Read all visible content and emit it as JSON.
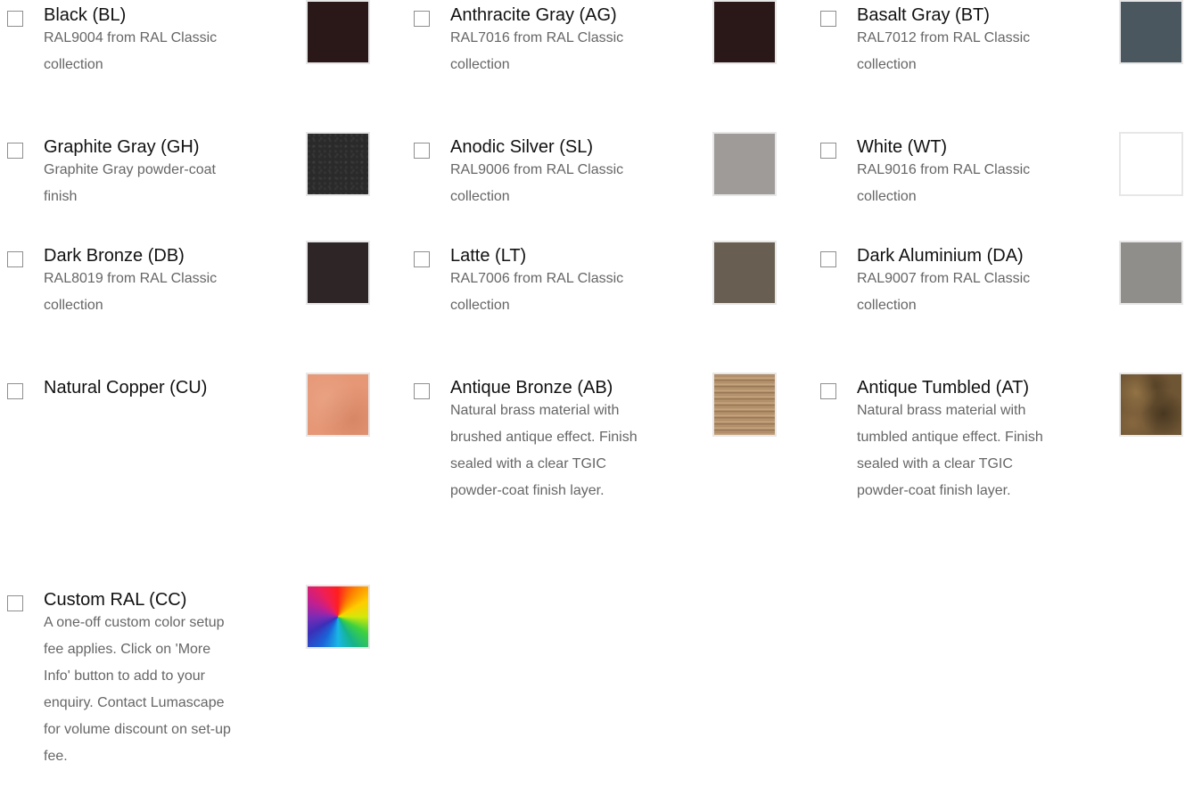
{
  "options": [
    {
      "name": "Black (BL)",
      "desc": "RAL9004 from RAL Classic collection",
      "swatch_color": "#2a1717"
    },
    {
      "name": "Anthracite Gray (AG)",
      "desc": "RAL7016 from RAL Classic collection",
      "swatch_color": "#2a1717"
    },
    {
      "name": "Basalt Gray (BT)",
      "desc": "RAL7012 from RAL Classic collection",
      "swatch_color": "#4a575e"
    },
    {
      "name": "Graphite Gray (GH)",
      "desc": "Graphite Gray powder-coat finish",
      "swatch_color": "#2a2a2a"
    },
    {
      "name": "Anodic Silver (SL)",
      "desc": "RAL9006 from RAL Classic collection",
      "swatch_color": "#9f9b99"
    },
    {
      "name": "White (WT)",
      "desc": "RAL9016 from RAL Classic collection",
      "swatch_color": "#ffffff"
    },
    {
      "name": "Dark Bronze (DB)",
      "desc": "RAL8019 from RAL Classic collection",
      "swatch_color": "#2e2527"
    },
    {
      "name": "Latte (LT)",
      "desc": "RAL7006 from RAL Classic collection",
      "swatch_color": "#685f52"
    },
    {
      "name": "Dark Aluminium (DA)",
      "desc": "RAL9007 from RAL Classic collection",
      "swatch_color": "#908e8b"
    },
    {
      "name": "Natural Copper (CU)",
      "desc": "",
      "swatch_color": "#e69775"
    },
    {
      "name": "Antique Bronze (AB)",
      "desc": "Natural brass material with brushed antique effect. Finish sealed with a clear TGIC powder-coat finish layer.",
      "swatch_color": "#b99670"
    },
    {
      "name": "Antique Tumbled (AT)",
      "desc": "Natural brass material with tumbled antique effect. Finish sealed with a clear TGIC powder-coat finish layer.",
      "swatch_color": "#6e5534"
    },
    {
      "name": "Custom RAL (CC)",
      "desc": "A one-off custom color setup fee applies. Click on 'More Info' button to add to your enquiry. Contact Lumascape for volume discount on set-up fee.",
      "swatch_color": "multicolor"
    }
  ]
}
